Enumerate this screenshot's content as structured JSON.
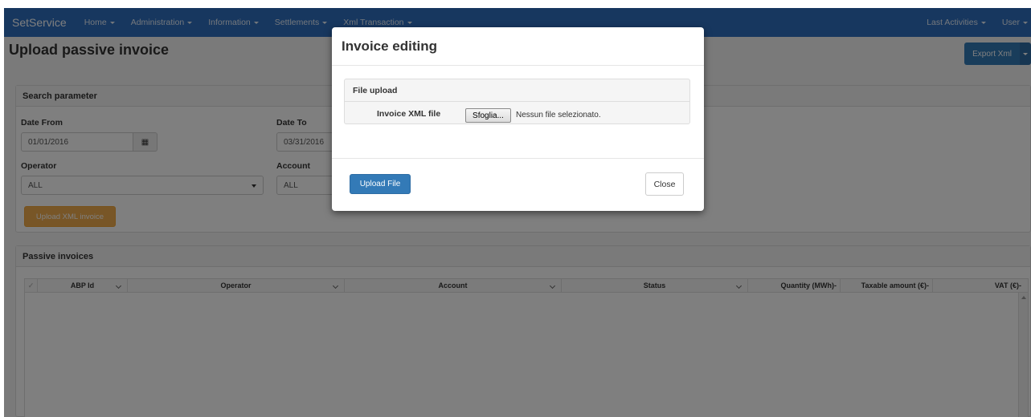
{
  "navbar": {
    "brand": "SetService",
    "menu": [
      {
        "label": "Home"
      },
      {
        "label": "Administration"
      },
      {
        "label": "Information"
      },
      {
        "label": "Settlements"
      },
      {
        "label": "Xml Transaction"
      }
    ],
    "right_menu": [
      {
        "label": "Last Activities"
      },
      {
        "label": "User"
      }
    ],
    "color": "#2f6ebf"
  },
  "page": {
    "title": "Upload passive invoice",
    "export_label": "Export Xml"
  },
  "search": {
    "heading": "Search parameter",
    "date_from_label": "Date From",
    "date_from_value": "01/01/2016",
    "date_to_label": "Date To",
    "date_to_value": "03/31/2016",
    "operator_label": "Operator",
    "operator_value": "ALL",
    "account_label": "Account",
    "account_value": "ALL",
    "upload_button": "Upload XML invoice"
  },
  "grid": {
    "heading": "Passive invoices",
    "columns": [
      "ABP Id",
      "Operator",
      "Account",
      "Status",
      "Quantity (MWh)-",
      "Taxable amount (€)-",
      "VAT (€)-"
    ]
  },
  "modal": {
    "title": "Invoice editing",
    "section": "File upload",
    "field_label": "Invoice XML file",
    "browse_label": "Sfoglia...",
    "file_status": "Nessun file selezionato.",
    "upload_button": "Upload File",
    "close_button": "Close"
  },
  "colors": {
    "primary": "#337ab7",
    "warning": "#f0ad4e"
  }
}
